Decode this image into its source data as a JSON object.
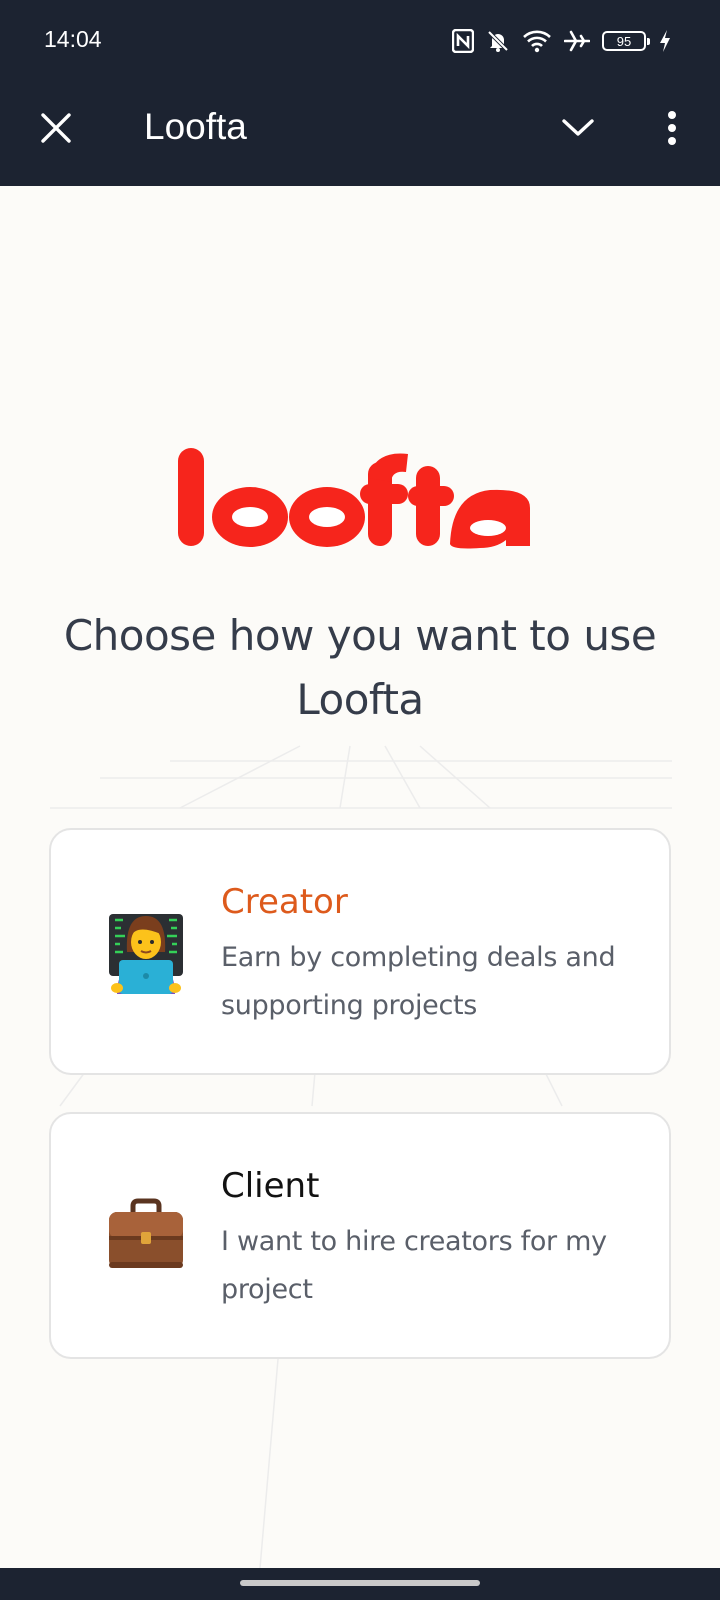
{
  "status_bar": {
    "time": "14:04",
    "battery_level": "95",
    "icons": [
      "nfc-icon",
      "bell-muted-icon",
      "wifi-icon",
      "airplane-icon",
      "battery-icon",
      "charging-bolt-icon"
    ]
  },
  "app_bar": {
    "title": "Loofta",
    "icons": [
      "close-icon",
      "chevron-down-icon",
      "more-vert-icon"
    ]
  },
  "logo": {
    "text": "loofta",
    "color": "#f6251c"
  },
  "headline": "Choose how you want to use Loofta",
  "options": [
    {
      "title": "Creator",
      "description": "Earn by completing deals and supporting projects",
      "icon": "woman-technologist-emoji",
      "title_color": "#dd5a1c"
    },
    {
      "title": "Client",
      "description": "I want to hire creators for my project",
      "icon": "briefcase-emoji",
      "title_color": "#121212"
    }
  ],
  "colors": {
    "bar_background": "#1c2331",
    "page_background": "#fcfbf8",
    "accent": "#dd5a1c"
  }
}
